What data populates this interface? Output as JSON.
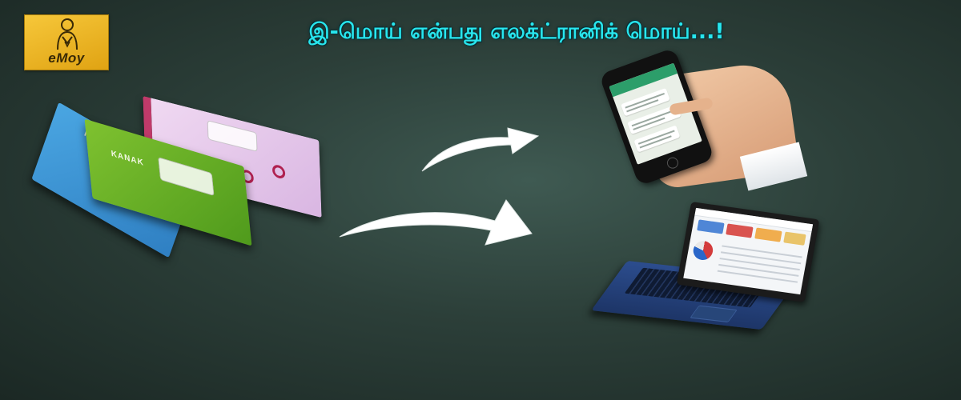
{
  "brand": {
    "logo_text": "eMoy",
    "logo_icon": "emoy-figure-icon",
    "logo_bg": "#f2bd2c"
  },
  "headline": {
    "text": "இ-மொய் என்பது எலக்ட்ரானிக் மொய்...!",
    "color": "#28e6ee"
  },
  "illustration": {
    "books": {
      "icon": "notebooks-icon",
      "brand_mark": "KANAK"
    },
    "arrows": [
      "arrow-to-phone-icon",
      "arrow-to-laptop-icon"
    ],
    "phone": {
      "icon": "smartphone-in-hand-icon"
    },
    "laptop": {
      "icon": "laptop-dashboard-icon"
    }
  }
}
